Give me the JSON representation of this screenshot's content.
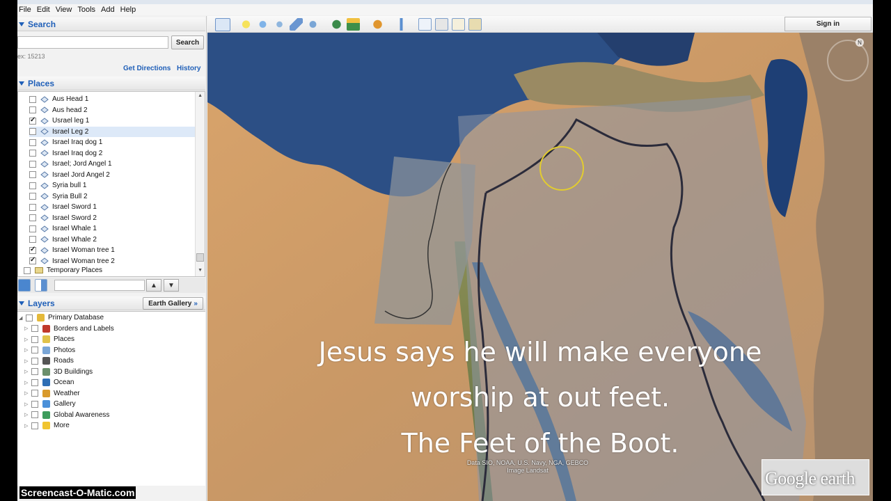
{
  "menu": [
    "File",
    "Edit",
    "View",
    "Tools",
    "Add",
    "Help"
  ],
  "search": {
    "title": "Search",
    "button": "Search",
    "hint": "ex: 15213",
    "get_directions": "Get Directions",
    "history": "History"
  },
  "places": {
    "title": "Places",
    "items": [
      {
        "label": "Aus Head 1",
        "checked": false
      },
      {
        "label": "Aus head 2",
        "checked": false
      },
      {
        "label": "Usrael leg 1",
        "checked": true
      },
      {
        "label": "Israel Leg 2",
        "checked": false,
        "selected": true
      },
      {
        "label": "Israel Iraq dog  1",
        "checked": false
      },
      {
        "label": "Israel Iraq dog 2",
        "checked": false
      },
      {
        "label": "Israel; Jord Angel 1",
        "checked": false
      },
      {
        "label": "Israel Jord Angel 2",
        "checked": false
      },
      {
        "label": "Syria bull 1",
        "checked": false
      },
      {
        "label": "Syria Bull 2",
        "checked": false
      },
      {
        "label": "Israel Sword 1",
        "checked": false
      },
      {
        "label": "Israel Sword 2",
        "checked": false
      },
      {
        "label": "Israel Whale 1",
        "checked": false
      },
      {
        "label": "Israel Whale 2",
        "checked": false
      },
      {
        "label": "Israel Woman tree 1",
        "checked": true
      },
      {
        "label": "Israel Woman tree 2",
        "checked": true
      }
    ],
    "temporary": "Temporary Places"
  },
  "layers": {
    "title": "Layers",
    "gallery_button": "Earth Gallery",
    "primary": "Primary Database",
    "items": [
      {
        "label": "Borders and Labels",
        "icon": "flag-icon"
      },
      {
        "label": "Places",
        "icon": "places-icon"
      },
      {
        "label": "Photos",
        "icon": "photos-icon"
      },
      {
        "label": "Roads",
        "icon": "roads-icon"
      },
      {
        "label": "3D Buildings",
        "icon": "buildings-icon"
      },
      {
        "label": "Ocean",
        "icon": "ocean-icon"
      },
      {
        "label": "Weather",
        "icon": "weather-icon"
      },
      {
        "label": "Gallery",
        "icon": "gallery-icon"
      },
      {
        "label": "Global Awareness",
        "icon": "globe-icon"
      },
      {
        "label": "More",
        "icon": "more-icon"
      }
    ]
  },
  "toolbar": {
    "sign_in": "Sign in"
  },
  "map": {
    "caption_lines": [
      "Jesus says he will make everyone",
      "worship at out feet.",
      "The Feet of the Boot."
    ],
    "attribution_1": "Data SIO, NOAA, U.S. Navy, NGA, GEBCO",
    "attribution_2": "Image Landsat",
    "logo_text": "Google earth"
  },
  "watermark": "Screencast-O-Matic.com",
  "colors": {
    "accent": "#1f5fb8",
    "sea": "#2b4f86",
    "desert": "#c99a66"
  }
}
